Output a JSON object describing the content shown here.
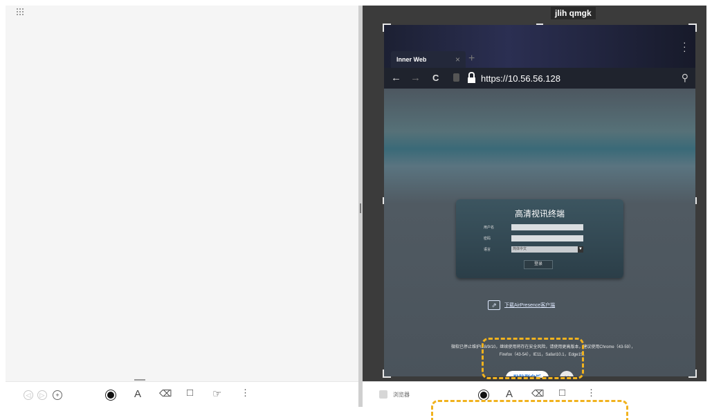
{
  "left": {
    "toolbar": {
      "pages": [
        "◁",
        "▷",
        "+"
      ],
      "tools": {
        "pen": "pen-icon",
        "text": "A",
        "eraser": "⌫",
        "shape": "□",
        "hand": "☞",
        "more": "⋮"
      }
    }
  },
  "right": {
    "window_title": "jlih qmgk",
    "browser": {
      "tab_label": "Inner Web",
      "tab_close": "×",
      "new_tab": "+",
      "url": "https://10.56.56.128",
      "back": "←",
      "forward": "→",
      "reload": "C",
      "search": "⚲",
      "login": {
        "title": "高清视讯终端",
        "username_label": "用户名",
        "password_label": "密码",
        "language_label": "语言",
        "language_value": "简体中文",
        "login_button": "登录"
      },
      "airpresence_link": "下载AirPresence客户端",
      "notice_line1": "微软已停止维护IE8/9/10，继续使用将存在安全风险，请使用更高版本，建议使用Chrome（43-59），",
      "notice_line2": "Firefox（43-54），IE11，Safari10.1，Edge15。"
    },
    "paste_button": "粘贴到白板",
    "close_button": "×",
    "toolbar": {
      "app_label": "浏览器",
      "tools": {
        "text": "A",
        "eraser": "⌫",
        "shape": "□",
        "more": "⋮"
      }
    }
  },
  "colors": {
    "highlight": "#f1b21e",
    "accent": "#2a7bd8"
  }
}
